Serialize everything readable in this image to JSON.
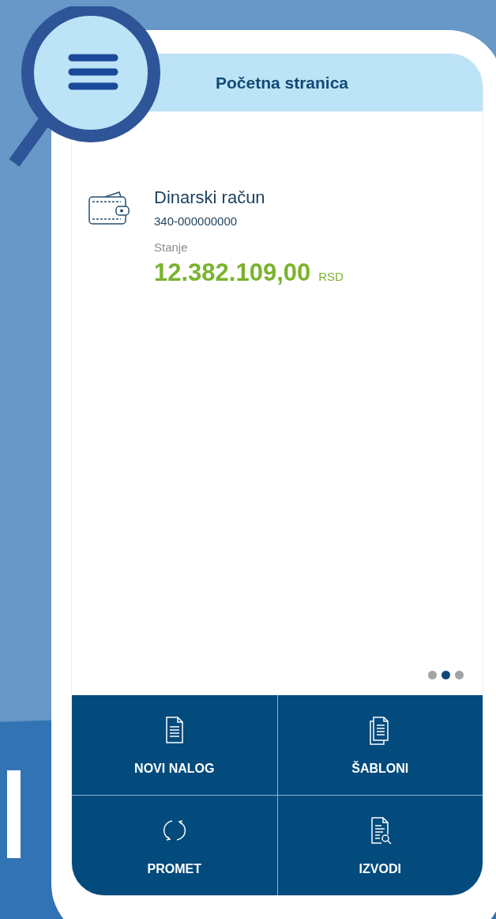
{
  "header": {
    "title": "Početna stranica"
  },
  "account": {
    "name": "Dinarski račun",
    "number": "340-000000000",
    "balance_label": "Stanje",
    "balance": "12.382.109,00",
    "currency": "RSD"
  },
  "pages": [
    {
      "selected": false
    },
    {
      "selected": true
    },
    {
      "selected": false
    }
  ],
  "actions": [
    {
      "label": "NOVI NALOG",
      "kind": "document"
    },
    {
      "label": "ŠABLONI",
      "kind": "documents"
    },
    {
      "label": "PROMET",
      "kind": "refresh"
    },
    {
      "label": "IZVODI",
      "kind": "search-document"
    }
  ]
}
